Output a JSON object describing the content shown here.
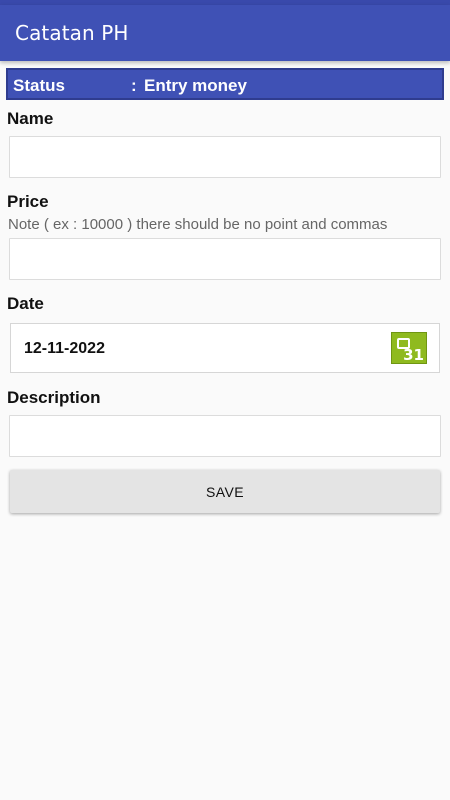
{
  "app": {
    "title": "Catatan PH"
  },
  "status": {
    "label": "Status",
    "separator": ":",
    "value": "Entry money"
  },
  "form": {
    "name_label": "Name",
    "name_value": "",
    "price_label": "Price",
    "price_note": "Note ( ex : 10000 ) there should be no point and commas",
    "price_value": "",
    "date_label": "Date",
    "date_value": "12-11-2022",
    "calendar_icon": "calendar-31-icon",
    "calendar_day": "31",
    "description_label": "Description",
    "description_value": "",
    "save_label": "SAVE"
  },
  "colors": {
    "app_bar": "#3f51b5",
    "status_bar": "#3949ab",
    "calendar_icon": "#8fba1f",
    "button": "#e4e4e4",
    "background": "#fafafa"
  }
}
